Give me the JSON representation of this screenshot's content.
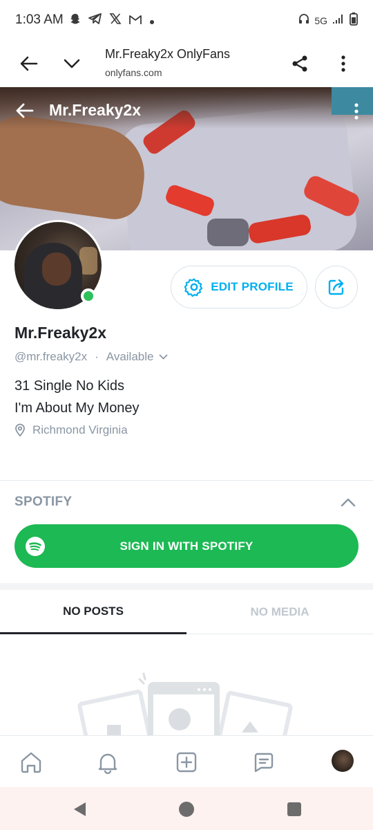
{
  "status_bar": {
    "time": "1:03 AM",
    "network": "5G",
    "left_icons": [
      "snapchat-icon",
      "telegram-icon",
      "x-icon",
      "gmail-icon",
      "dot-icon"
    ],
    "right_icons": [
      "headphones-icon",
      "signal-icon",
      "battery-icon"
    ]
  },
  "browser": {
    "title": "Mr.Freaky2x OnlyFans",
    "url": "onlyfans.com"
  },
  "profile": {
    "cover_name": "Mr.Freaky2x",
    "name": "Mr.Freaky2x",
    "handle": "@mr.freaky2x",
    "separator": "·",
    "availability": "Available",
    "bio_lines": [
      "31 Single No Kids",
      "I'm About My Money"
    ],
    "location": "Richmond Virginia",
    "online": true
  },
  "actions": {
    "edit_profile": "EDIT PROFILE"
  },
  "spotify": {
    "title": "SPOTIFY",
    "sign_in": "SIGN IN WITH SPOTIFY"
  },
  "tabs": [
    {
      "label": "NO POSTS",
      "active": true
    },
    {
      "label": "NO MEDIA",
      "active": false
    }
  ],
  "bottom_nav": [
    "home-icon",
    "bell-icon",
    "add-post-icon",
    "messages-icon",
    "profile-avatar"
  ],
  "colors": {
    "accent": "#00aff0",
    "spotify_green": "#1db954",
    "online_green": "#2ec05a",
    "muted_text": "#8a96a3"
  }
}
